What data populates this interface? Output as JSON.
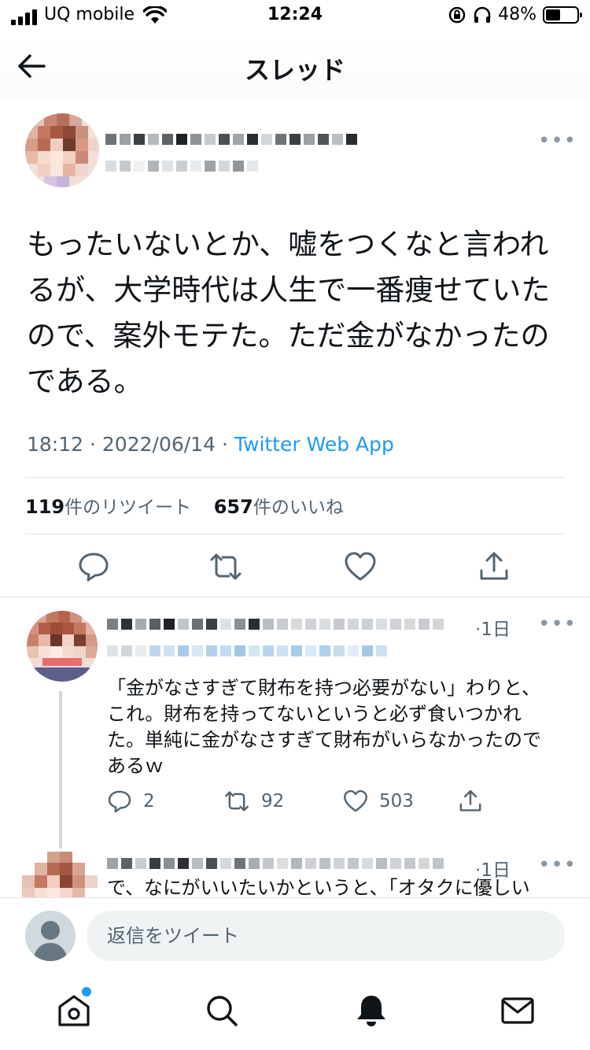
{
  "status_bar": {
    "carrier": "UQ mobile",
    "time": "12:24",
    "battery": "48%",
    "battery_level": 0.48
  },
  "header": {
    "title": "スレッド"
  },
  "main_tweet": {
    "text": "もったいないとか、嘘をつくなと言われるが、大学時代は人生で一番痩せていたので、案外モテた。ただ金がなかったのである。",
    "time": "18:12",
    "date": "2022/06/14",
    "separator": "·",
    "source": "Twitter Web App",
    "retweet_count": "119",
    "retweet_label": "件のリツイート",
    "like_count": "657",
    "like_label": "件のいいね"
  },
  "reply": {
    "age": "·1日",
    "text": "「金がなさすぎて財布を持つ必要がない」わりと、これ。財布を持ってないというと必ず食いつかれた。単純に金がなさすぎて財布がいらなかったのであるｗ",
    "reply_count": "2",
    "retweet_count": "92",
    "like_count": "503"
  },
  "reply2": {
    "age": "·1日",
    "text": "で、なにがいいたいかというと、「オタクに優しい"
  },
  "composer": {
    "placeholder": "返信をツイート"
  },
  "colors": {
    "accent": "#1d9bf0",
    "text": "#0f1419",
    "secondary": "#536471"
  }
}
